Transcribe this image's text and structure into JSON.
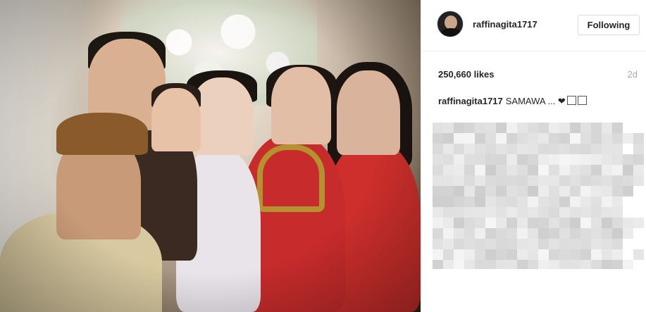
{
  "post": {
    "username": "raffinagita1717",
    "follow_button": "Following",
    "likes": "250,660 likes",
    "time_ago": "2d",
    "caption_user": "raffinagita1717",
    "caption_text": "SAMAWA ... ❤"
  },
  "icons": {
    "avatar": "profile-avatar",
    "caption_emoji": "pixel-emoji-icon"
  },
  "colors": {
    "text": "#262626",
    "muted": "#a8a8a8",
    "border": "#dbdbdb"
  }
}
